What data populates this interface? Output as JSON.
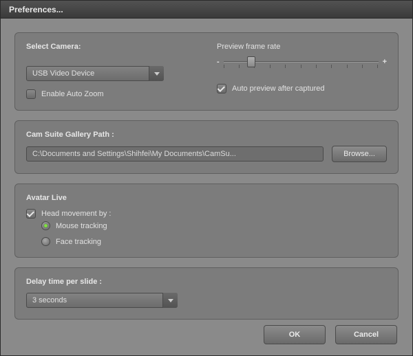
{
  "window": {
    "title": "Preferences..."
  },
  "camera": {
    "section_label": "Select Camera:",
    "device": "USB Video Device",
    "enable_auto_zoom_label": "Enable Auto Zoom",
    "enable_auto_zoom_checked": false,
    "preview_frame_rate_label": "Preview frame rate",
    "slider_minus": "-",
    "slider_plus": "+",
    "slider_value_percent": 18,
    "auto_preview_label": "Auto preview after captured",
    "auto_preview_checked": true
  },
  "gallery": {
    "section_label": "Cam Suite Gallery Path :",
    "path": "C:\\Documents and Settings\\Shihfei\\My Documents\\CamSu...",
    "browse_label": "Browse..."
  },
  "avatar": {
    "section_label": "Avatar Live",
    "head_movement_label": "Head movement by :",
    "head_movement_checked": true,
    "options": [
      {
        "label": "Mouse tracking",
        "selected": true
      },
      {
        "label": "Face tracking",
        "selected": false
      }
    ]
  },
  "delay": {
    "section_label": "Delay time per slide :",
    "value": "3 seconds"
  },
  "footer": {
    "ok": "OK",
    "cancel": "Cancel"
  }
}
